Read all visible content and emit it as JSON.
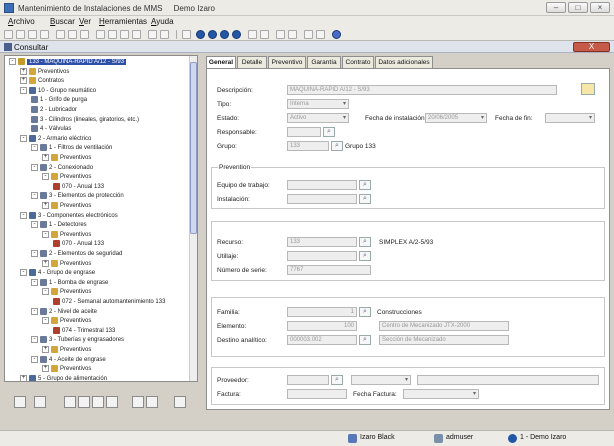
{
  "window": {
    "title": "Mantenimiento de Instalaciones de MMS",
    "company": "Demo Izaro"
  },
  "menu": [
    "Archivo",
    "Buscar",
    "Ver",
    "Herramientas",
    "Ayuda"
  ],
  "doc": {
    "title": "Consultar",
    "close_label": "X"
  },
  "tree": [
    {
      "label": "133 - MAQUINA-RAPID A/12 - S/93",
      "selected": true
    },
    {
      "label": "Preventivos"
    },
    {
      "label": "Contratos"
    },
    {
      "label": "10 - Grupo neumático"
    },
    {
      "label": "1 - Grifo de purga"
    },
    {
      "label": "2 - Lubricador"
    },
    {
      "label": "3 - Cilindros (lineales, giratorios, etc.)"
    },
    {
      "label": "4 - Válvulas"
    },
    {
      "label": "2 - Armario eléctrico"
    },
    {
      "label": "1 - Filtros de ventilación"
    },
    {
      "label": "Preventivos"
    },
    {
      "label": "2 - Conexionado"
    },
    {
      "label": "Preventivos"
    },
    {
      "label": "070 - Anual 133"
    },
    {
      "label": "3 - Elementos de protección"
    },
    {
      "label": "Preventivos"
    },
    {
      "label": "3 - Componentes electrónicos"
    },
    {
      "label": "1 - Detectores"
    },
    {
      "label": "Preventivos"
    },
    {
      "label": "070 - Anual 133"
    },
    {
      "label": "2 - Elementos de seguridad"
    },
    {
      "label": "Preventivos"
    },
    {
      "label": "4 - Grupo de engrase"
    },
    {
      "label": "1 - Bomba de engrase"
    },
    {
      "label": "Preventivos"
    },
    {
      "label": "072 - Semanal automantenimiento 133"
    },
    {
      "label": "2 - Nivel de aceite"
    },
    {
      "label": "Preventivos"
    },
    {
      "label": "074 - Trimestral 133"
    },
    {
      "label": "3 - Tuberías y engrasadores"
    },
    {
      "label": "Preventivos"
    },
    {
      "label": "4 - Aceite de engrase"
    },
    {
      "label": "Preventivos"
    },
    {
      "label": "5 - Grupo de alimentación"
    }
  ],
  "tabs": [
    "General",
    "Detalle",
    "Preventivo",
    "Garantía",
    "Contrato",
    "Datos adicionales"
  ],
  "form": {
    "descripcion_label": "Descripción:",
    "descripcion_value": "MAQUINA-RAPID A/12 - S/93",
    "tipo_label": "Tipo:",
    "tipo_value": "Interna",
    "estado_label": "Estado:",
    "estado_value": "Activo",
    "fecha_inst_label": "Fecha de instalación:",
    "fecha_inst_value": "20/06/2005",
    "fecha_fin_label": "Fecha de fin:",
    "responsable_label": "Responsable:",
    "grupo_label": "Grupo:",
    "grupo_value": "133",
    "grupo_desc": "Grupo 133",
    "prevention_title": "Prevention",
    "equipo_label": "Equipo de trabajo:",
    "instalacion_label": "Instalación:",
    "recurso_label": "Recurso:",
    "recurso_value": "133",
    "recurso_desc": "SIMPLEX A/2-5/93",
    "utillaje_label": "Utillaje:",
    "num_serie_label": "Número de serie:",
    "num_serie_value": "7767",
    "familia_label": "Familia:",
    "familia_value": "1",
    "familia_desc": "Construcciones",
    "elemento_label": "Elemento:",
    "elemento_value": "100",
    "elemento_desc": "Centro de Mecanizado JTX-2000",
    "destino_label": "Destino analítico:",
    "destino_value": "000003.002",
    "destino_desc": "Sección de Mecanizado",
    "proveedor_label": "Proveedor:",
    "factura_label": "Factura:",
    "fecha_factura_label": "Fecha Factura:"
  },
  "status": {
    "user1": "Izaro Black",
    "user2": "admuser",
    "company": "1 - Demo Izaro"
  }
}
